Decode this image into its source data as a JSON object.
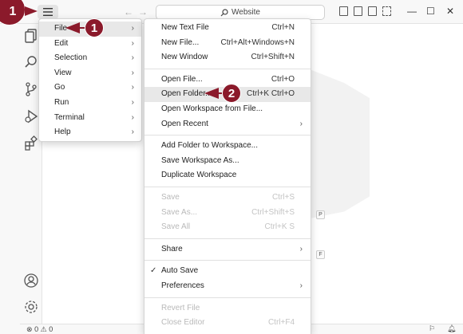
{
  "titlebar": {
    "search_text": "Website"
  },
  "main_menu": {
    "items": [
      {
        "label": "File"
      },
      {
        "label": "Edit"
      },
      {
        "label": "Selection"
      },
      {
        "label": "View"
      },
      {
        "label": "Go"
      },
      {
        "label": "Run"
      },
      {
        "label": "Terminal"
      },
      {
        "label": "Help"
      }
    ]
  },
  "file_menu": {
    "new_text_file": {
      "label": "New Text File",
      "shortcut": "Ctrl+N"
    },
    "new_file": {
      "label": "New File...",
      "shortcut": "Ctrl+Alt+Windows+N"
    },
    "new_window": {
      "label": "New Window",
      "shortcut": "Ctrl+Shift+N"
    },
    "open_file": {
      "label": "Open File...",
      "shortcut": "Ctrl+O"
    },
    "open_folder": {
      "label": "Open Folder...",
      "shortcut": "Ctrl+K Ctrl+O"
    },
    "open_workspace": {
      "label": "Open Workspace from File..."
    },
    "open_recent": {
      "label": "Open Recent"
    },
    "add_folder": {
      "label": "Add Folder to Workspace..."
    },
    "save_workspace_as": {
      "label": "Save Workspace As..."
    },
    "duplicate_workspace": {
      "label": "Duplicate Workspace"
    },
    "save": {
      "label": "Save",
      "shortcut": "Ctrl+S"
    },
    "save_as": {
      "label": "Save As...",
      "shortcut": "Ctrl+Shift+S"
    },
    "save_all": {
      "label": "Save All",
      "shortcut": "Ctrl+K S"
    },
    "share": {
      "label": "Share"
    },
    "auto_save": {
      "label": "Auto Save",
      "check": "✓"
    },
    "preferences": {
      "label": "Preferences"
    },
    "revert_file": {
      "label": "Revert File"
    },
    "close_editor": {
      "label": "Close Editor",
      "shortcut": "Ctrl+F4"
    }
  },
  "editor": {
    "hint_p": "P",
    "hint_f": "F"
  },
  "statusbar": {
    "errors": "0",
    "warnings": "0"
  },
  "callouts": {
    "step1": "1",
    "step1_menu": "1",
    "step2": "2"
  },
  "colors": {
    "callout": "#8b1a2b"
  }
}
